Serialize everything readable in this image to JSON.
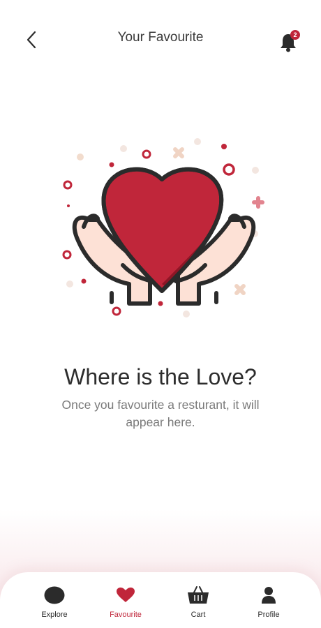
{
  "header": {
    "title": "Your Favourite",
    "notification_count": "2"
  },
  "empty_state": {
    "title": "Where is the Love?",
    "subtitle": "Once you favourite a resturant, it will appear here."
  },
  "bottom_nav": {
    "items": [
      {
        "label": "Explore",
        "icon": "explore-icon"
      },
      {
        "label": "Favourite",
        "icon": "heart-icon",
        "active": true
      },
      {
        "label": "Cart",
        "icon": "basket-icon"
      },
      {
        "label": "Profile",
        "icon": "person-icon"
      }
    ]
  },
  "colors": {
    "accent": "#c0263a",
    "heart": "#c0263a",
    "heart_dark": "#8f1626",
    "outline": "#2b2b2b",
    "skin": "#fde1d6"
  }
}
